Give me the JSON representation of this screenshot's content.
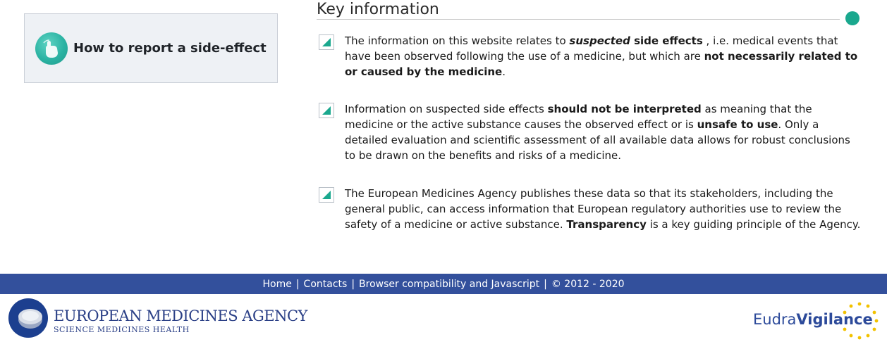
{
  "report": {
    "label": "How to report a side-effect",
    "icon": "hand-pointer-icon"
  },
  "key_info": {
    "title": "Key information",
    "accent_color": "#1aa88e",
    "items": [
      [
        {
          "t": "The information on this website relates to ",
          "s": ""
        },
        {
          "t": "suspected",
          "s": "bi"
        },
        {
          "t": " side effects",
          "s": "b"
        },
        {
          "t": " , i.e. medical events that have been observed following the use of a medicine, but which are ",
          "s": ""
        },
        {
          "t": "not necessarily related to or caused by the medicine",
          "s": "b"
        },
        {
          "t": ".",
          "s": ""
        }
      ],
      [
        {
          "t": "Information on suspected side effects ",
          "s": ""
        },
        {
          "t": "should not be interpreted",
          "s": "b"
        },
        {
          "t": " as meaning that the medicine or the active substance causes the observed effect or is ",
          "s": ""
        },
        {
          "t": "unsafe to use",
          "s": "b"
        },
        {
          "t": ". Only a detailed evaluation and scientific assessment of all available data allows for robust conclusions to be drawn on the benefits and risks of a medicine.",
          "s": ""
        }
      ],
      [
        {
          "t": "The European Medicines Agency publishes these data so that its stakeholders, including the general public, can access information that European regulatory authorities use to review the safety of a medicine or active substance. ",
          "s": ""
        },
        {
          "t": "Transparency",
          "s": "b"
        },
        {
          "t": " is a key guiding principle of the Agency.",
          "s": ""
        }
      ]
    ]
  },
  "footer": {
    "bar_color": "#33509c",
    "links": [
      "Home",
      "Contacts",
      "Browser compatibility and Javascript"
    ],
    "copyright": "© 2012 - 2020"
  },
  "ema": {
    "name": "EUROPEAN MEDICINES AGENCY",
    "tagline": "SCIENCE MEDICINES HEALTH"
  },
  "eudravigilance": {
    "light": "Eudra",
    "bold": "Vigilance"
  }
}
